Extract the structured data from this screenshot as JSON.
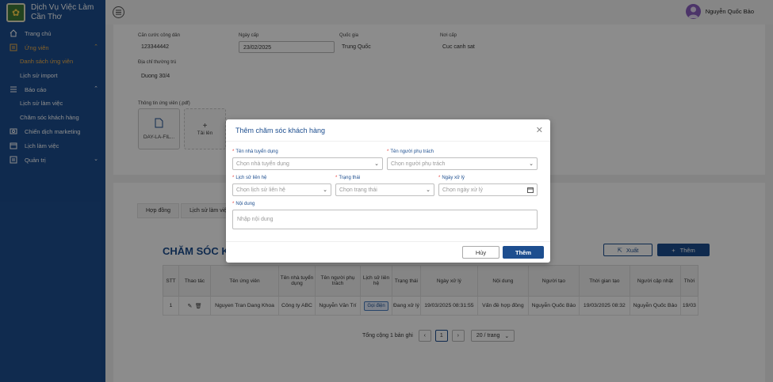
{
  "app": {
    "name_line1": "Dịch Vụ Việc Làm",
    "name_line2": "Cần Thơ"
  },
  "sidebar": {
    "items": [
      {
        "label": "Trang chủ",
        "icon": "home-icon"
      },
      {
        "label": "Ứng viên",
        "icon": "candidate-icon",
        "expanded": true
      },
      {
        "label": "Danh sách ứng viên",
        "sub": true,
        "active": true
      },
      {
        "label": "Lịch sử import",
        "sub": true
      },
      {
        "label": "Báo cáo",
        "icon": "list-icon",
        "expanded": true
      },
      {
        "label": "Lịch sử làm việc",
        "sub": true
      },
      {
        "label": "Chăm sóc khách hàng",
        "sub": true
      },
      {
        "label": "Chiến dịch marketing",
        "icon": "campaign-icon"
      },
      {
        "label": "Lịch làm việc",
        "icon": "calendar-icon"
      },
      {
        "label": "Quản trị",
        "icon": "admin-icon",
        "expanded": false
      }
    ]
  },
  "topbar": {
    "user_name": "Nguyễn Quốc Bảo"
  },
  "profile": {
    "id_label": "Căn cước công dân",
    "id_value": "123344442",
    "issue_date_label": "Ngày cấp",
    "issue_date_value": "23/02/2025",
    "nationality_label": "Quốc gia",
    "nationality_value": "Trung Quốc",
    "issue_place_label": "Nơi cấp",
    "issue_place_value": "Cuc canh sat",
    "address_label": "Địa chỉ thường trú",
    "address_value": "Duong 30/4",
    "file_label": "Thông tin ứng viên (.pdf)",
    "file_name": "DAY-LA-FIL...",
    "upload_label": "Tải lên"
  },
  "tabs": [
    "Hợp đồng",
    "Lịch sử làm việc"
  ],
  "section_title": "CHĂM SÓC KH",
  "actions": {
    "export_label": "Xuất",
    "add_label": "Thêm"
  },
  "table": {
    "columns": [
      "STT",
      "Thao tác",
      "Tên ứng viên",
      "Tên nhà tuyển dụng",
      "Tên người phụ trách",
      "Lịch sử liên hệ",
      "Trạng thái",
      "Ngày xử lý",
      "Nội dung",
      "Người tạo",
      "Thời gian tạo",
      "Người cập nhật",
      "Thời"
    ],
    "rows": [
      {
        "stt": "1",
        "candidate": "Nguyen Tran Dang Khoa",
        "employer": "Công ty ABC",
        "owner": "Nguyễn Văn Trí",
        "contact": "Gọi điện",
        "status": "Đang xử lý",
        "processed": "19/03/2025 08:31:55",
        "content": "Vấn đề hợp đồng",
        "creator": "Nguyễn Quốc Bảo",
        "created": "19/03/2025 08:32",
        "updater": "Nguyễn Quốc Bảo",
        "updated": "19/03"
      }
    ]
  },
  "pager": {
    "total": "Tổng cộng 1 bản ghi",
    "page": "1",
    "page_size": "20 / trang"
  },
  "modal": {
    "title": "Thêm chăm sóc khách hàng",
    "employer_label": "Tên nhà tuyển dụng",
    "employer_placeholder": "Chọn nhà tuyển dụng",
    "owner_label": "Tên người phụ trách",
    "owner_placeholder": "Chọn người phụ trách",
    "contact_label": "Lịch sử liên hệ",
    "contact_placeholder": "Chọn lịch sử liên hệ",
    "status_label": "Trạng thái",
    "status_placeholder": "Chọn trạng thái",
    "date_label": "Ngày xử lý",
    "date_placeholder": "Chọn ngày xử lý",
    "content_label": "Nội dung",
    "content_placeholder": "Nhập nội dung",
    "cancel_label": "Hủy",
    "submit_label": "Thêm"
  }
}
